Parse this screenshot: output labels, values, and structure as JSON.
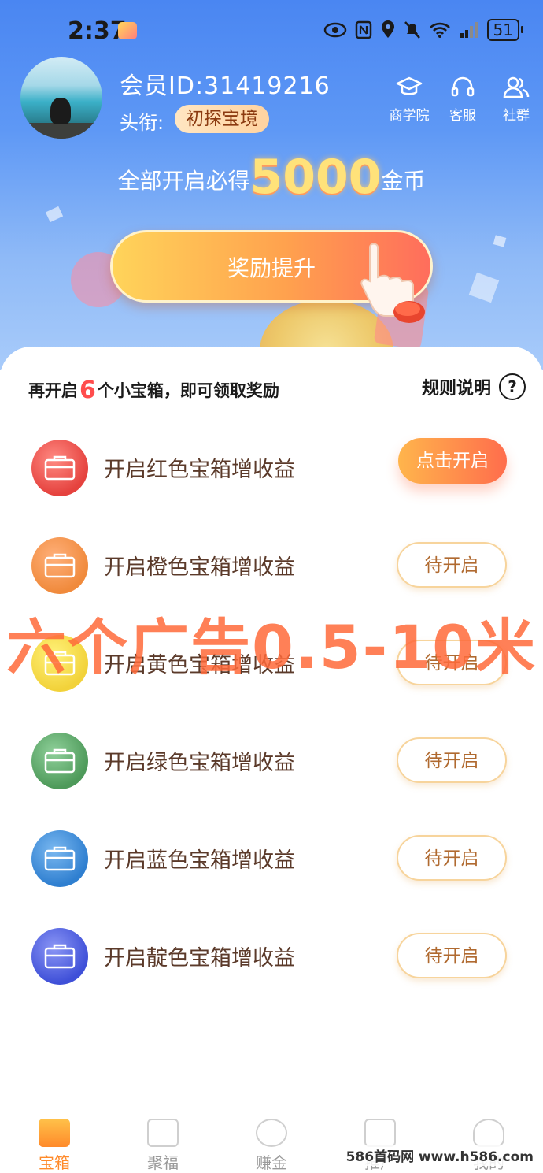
{
  "status_bar": {
    "time": "2:37",
    "battery": "51"
  },
  "profile": {
    "member_id": "会员ID:31419216",
    "title_label": "头衔:",
    "title_badge": "初探宝境"
  },
  "top_actions": [
    {
      "label": "商学院",
      "icon": "graduation-cap-icon"
    },
    {
      "label": "客服",
      "icon": "headset-icon"
    },
    {
      "label": "社群",
      "icon": "group-icon"
    }
  ],
  "headline": {
    "prefix": "全部开启必得",
    "amount": "5000",
    "suffix": "金币"
  },
  "reward_button": {
    "label": "奖励提升"
  },
  "progress": {
    "prefix": "再开启",
    "count": "6",
    "suffix": "个小宝箱，即可领取奖励"
  },
  "rules": {
    "label": "规则说明",
    "icon": "help-icon",
    "icon_text": "?"
  },
  "chests": [
    {
      "label": "开启红色宝箱增收益",
      "button": "点击开启",
      "state": "active",
      "color": "#e5423e"
    },
    {
      "label": "开启橙色宝箱增收益",
      "button": "待开启",
      "state": "pending",
      "color": "#f08a3c"
    },
    {
      "label": "开启黄色宝箱增收益",
      "button": "待开启",
      "state": "pending",
      "color": "#f2d23a"
    },
    {
      "label": "开启绿色宝箱增收益",
      "button": "待开启",
      "state": "pending",
      "color": "#4e9a5a"
    },
    {
      "label": "开启蓝色宝箱增收益",
      "button": "待开启",
      "state": "pending",
      "color": "#2f7fd0"
    },
    {
      "label": "开启靛色宝箱增收益",
      "button": "待开启",
      "state": "pending",
      "color": "#3f50d8"
    }
  ],
  "overlay_text": "六个广告0.5-10米",
  "bottom_nav": [
    {
      "label": "宝箱",
      "icon": "treasure-box-icon",
      "active": true
    },
    {
      "label": "聚福",
      "icon": "play-icon",
      "active": false
    },
    {
      "label": "赚金",
      "icon": "coins-icon",
      "active": false
    },
    {
      "label": "推广",
      "icon": "star-icon",
      "active": false
    },
    {
      "label": "我的",
      "icon": "user-icon",
      "active": false
    }
  ],
  "site_watermark": "586首码网 www.h586.com"
}
